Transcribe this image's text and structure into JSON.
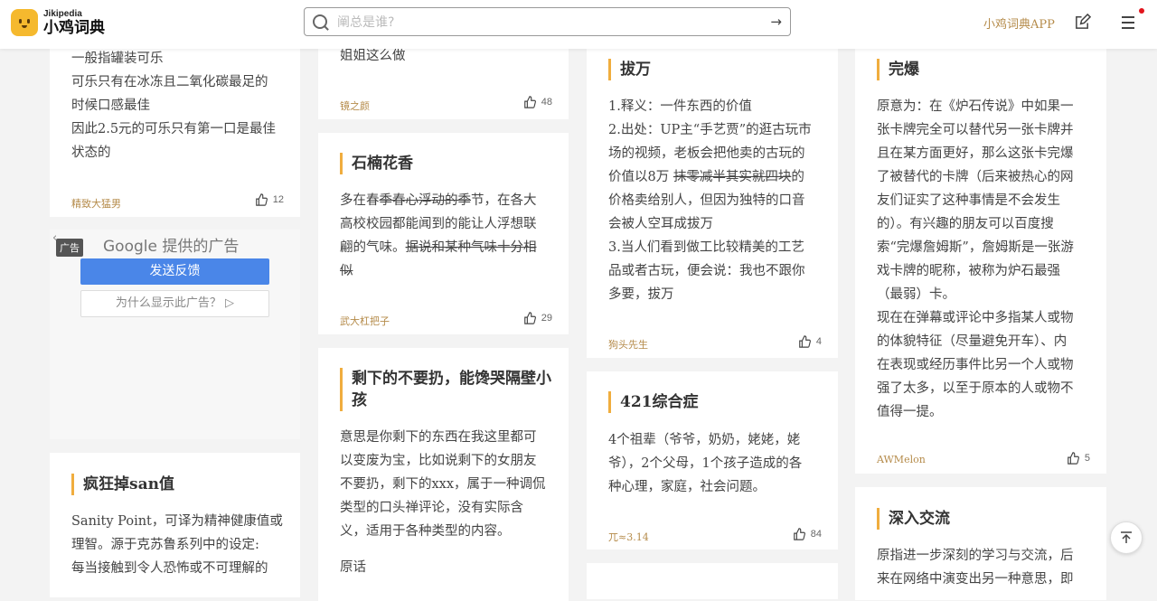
{
  "header": {
    "logo_en": "Jikipedia",
    "logo_cn": "小鸡词典",
    "search_placeholder": "阐总是谁?",
    "app_link": "小鸡词典APP"
  },
  "cards": {
    "kele": {
      "lines": [
        "一般指罐装可乐",
        "可乐只有在冰冻且二氧化碳最足的",
        "时候口感最佳",
        "因此2.5元的可乐只有第一口是最佳",
        "状态的"
      ],
      "author": "精致大猛男",
      "likes": "12"
    },
    "jiejie": {
      "lines": [
        "姐姐这么做"
      ],
      "author": "镜之颜",
      "likes": "48"
    },
    "shiliu": {
      "title": "石楠花香",
      "line1a": "多在春",
      "line1s": "季春心浮动的季",
      "line1b": "节，在各大",
      "line2": "高校校园都能闻到的能让人浮想联",
      "line3a": "翩的气味。",
      "line3s": "据说和某种气味十分相",
      "line4s": "似",
      "author": "武大杠把子",
      "likes": "29"
    },
    "shengxia": {
      "title_line1": "剩下的不要扔，能馋哭隔壁小",
      "title_line2": "孩",
      "lines": [
        "意思是你剩下的东西在我这里都可",
        "以变废为宝，比如说剩下的女朋友",
        "不要扔，剩下的xxx，属于一种调侃",
        "类型的口头禅评论，没有实际含",
        "义，适用于各种类型的内容。"
      ],
      "extra": "原话"
    },
    "fengkuang": {
      "title": "疯狂掉san值",
      "lines": [
        "Sanity Point，可译为精神健康值或",
        "理智。源于克苏鲁系列中的设定:",
        "每当接触到令人恐怖或不可理解的"
      ]
    },
    "bawan": {
      "title": "拔万",
      "line1": "1.释义：一件东西的价值",
      "line2": "2.出处：UP主“手艺贾”的逛古玩市",
      "line3": "场的视频，老板会把他卖的古玩的",
      "line4a": "价值以8万 ",
      "line4s": "抹零减半其实就四块",
      "line4b": "的",
      "line5": "价格卖给别人，但因为独特的口音",
      "line6": "会被人空耳成拔万",
      "line7": "3.当人们看到做工比较精美的工艺",
      "line8": "品或者古玩，便会说：我也不跟你",
      "line9": "多要，拔万",
      "author": "狗头先生",
      "likes": "4"
    },
    "z421": {
      "title": "421综合症",
      "lines": [
        "4个祖辈（爷爷，奶奶，姥姥，姥",
        "爷），2个父母，1个孩子造成的各",
        "种心理，家庭，社会问题。"
      ],
      "author": "兀≈3.14",
      "likes": "84"
    },
    "wanbao": {
      "title": "完爆",
      "lines": [
        "原意为：在《炉石传说》中如果一",
        "张卡牌完全可以替代另一张卡牌并",
        "且在某方面更好，那么这张卡完爆",
        "了被替代的卡牌（后来被热心的网",
        "友们证实了这种事情是不会发生",
        "的）。有兴趣的朋友可以百度搜",
        "索“完爆詹姆斯”，詹姆斯是一张游",
        "戏卡牌的昵称，被称为炉石最强",
        "（最弱）卡。",
        "现在在弹幕或评论中多指某人或物",
        "的体貌特征（尽量避免开车）、内",
        "在表现或经历事件比另一个人或物",
        "强了太多，以至于原本的人或物不",
        "值得一提。"
      ],
      "author": "AWMelon",
      "likes": "5"
    },
    "shenru": {
      "title": "深入交流",
      "lines": [
        "原指进一步深刻的学习与交流，后",
        "来在网络中演变出另一种意思，即"
      ]
    }
  },
  "ad": {
    "label": "广告",
    "title": "Google 提供的广告",
    "feedback": "发送反馈",
    "why": "为什么显示此广告？ ▷"
  },
  "colors": {
    "accent": "#f0ad3e",
    "author": "#b58b4a",
    "ad_button": "#4a86e8"
  }
}
